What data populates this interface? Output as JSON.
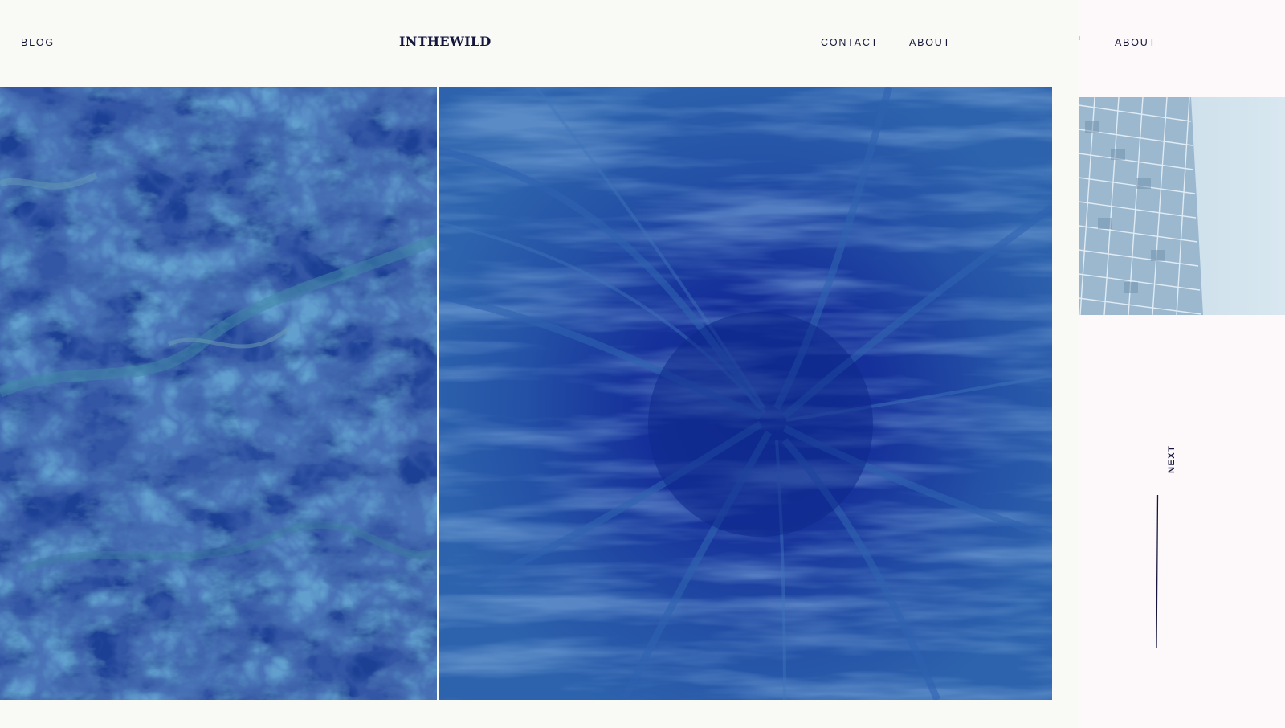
{
  "header": {
    "blog_label": "BLOG",
    "brand": "INTHEWILD",
    "contact_label": "CONTACT",
    "about_label": "ABOUT"
  },
  "gallery": {
    "tiles": [
      {
        "subject": "marbled-blue-rock",
        "tint": "#1f3f95"
      },
      {
        "subject": "blue-paint-swirl",
        "tint": "#1a47a0"
      }
    ]
  },
  "next_preview": {
    "about_label": "ABOUT",
    "next_label": "NEXT",
    "image_subject": "glass-building-facade"
  },
  "colors": {
    "page_background": "#f9faf5",
    "next_background": "#fdf9fa",
    "text": "#15163a",
    "accent_blue": "#1a3f9a"
  }
}
